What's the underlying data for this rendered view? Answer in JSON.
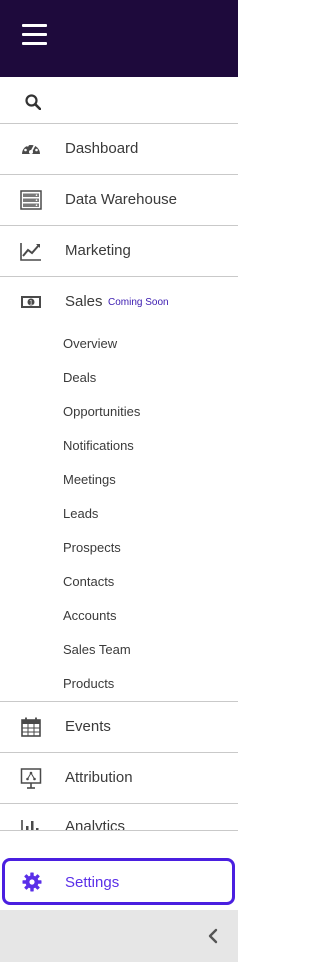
{
  "sidebar": {
    "nav": {
      "dashboard": "Dashboard",
      "data_warehouse": "Data Warehouse",
      "marketing": "Marketing",
      "sales": "Sales",
      "sales_badge": "Coming Soon",
      "events": "Events",
      "attribution": "Attribution",
      "analytics": "Analytics",
      "settings": "Settings"
    },
    "sales_sub": {
      "overview": "Overview",
      "deals": "Deals",
      "opportunities": "Opportunities",
      "notifications": "Notifications",
      "meetings": "Meetings",
      "leads": "Leads",
      "prospects": "Prospects",
      "contacts": "Contacts",
      "accounts": "Accounts",
      "sales_team": "Sales Team",
      "products": "Products"
    }
  },
  "colors": {
    "topbar": "#1e0a3c",
    "accent": "#4a1fe0",
    "badge": "#3a1ab0",
    "footer": "#e6e6e6"
  },
  "icons": {
    "menu": "hamburger-icon",
    "search": "search-icon",
    "dashboard": "speedometer-icon",
    "data_warehouse": "server-icon",
    "marketing": "trend-chart-icon",
    "sales": "money-icon",
    "events": "calendar-icon",
    "attribution": "presentation-icon",
    "analytics": "bar-chart-icon",
    "settings": "gear-icon",
    "collapse": "chevron-left-icon"
  }
}
